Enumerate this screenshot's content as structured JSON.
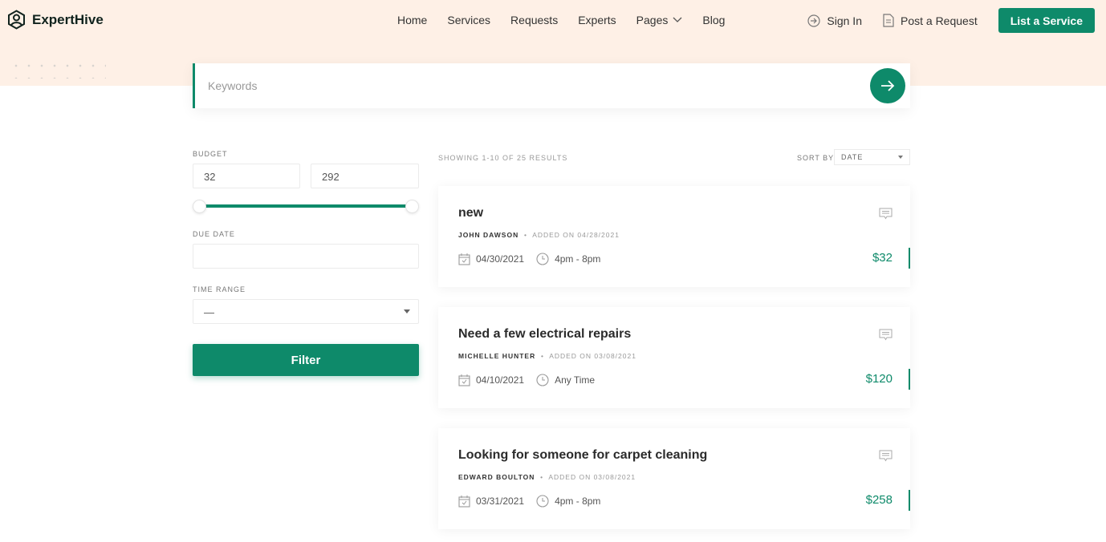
{
  "brand": {
    "name": "ExpertHive"
  },
  "nav": [
    "Home",
    "Services",
    "Requests",
    "Experts",
    "Pages",
    "Blog"
  ],
  "header": {
    "sign_in": "Sign In",
    "post_request": "Post a Request",
    "list_service": "List a Service"
  },
  "search": {
    "placeholder": "Keywords"
  },
  "filters": {
    "budget_label": "BUDGET",
    "budget_min": "32",
    "budget_max": "292",
    "due_date_label": "DUE DATE",
    "due_date_value": "",
    "time_range_label": "TIME RANGE",
    "time_range_value": "—",
    "filter_button": "Filter"
  },
  "results": {
    "showing": "SHOWING 1-10 OF 25 RESULTS",
    "sort_label": "SORT BY",
    "sort_value": "DATE"
  },
  "accent": "#0e8a6a",
  "requests": [
    {
      "title": "new",
      "author": "JOHN DAWSON",
      "added": "ADDED ON 04/28/2021",
      "date": "04/30/2021",
      "time": "4pm - 8pm",
      "price": "$32"
    },
    {
      "title": "Need a few electrical repairs",
      "author": "MICHELLE HUNTER",
      "added": "ADDED ON 03/08/2021",
      "date": "04/10/2021",
      "time": "Any Time",
      "price": "$120"
    },
    {
      "title": "Looking for someone for carpet cleaning",
      "author": "EDWARD BOULTON",
      "added": "ADDED ON 03/08/2021",
      "date": "03/31/2021",
      "time": "4pm - 8pm",
      "price": "$258"
    }
  ]
}
